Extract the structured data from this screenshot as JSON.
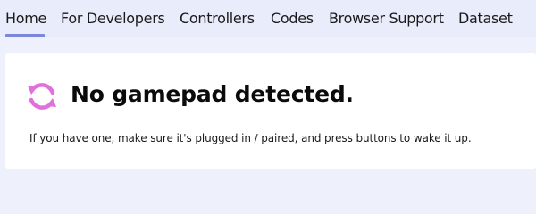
{
  "nav": {
    "items": [
      {
        "label": "Home",
        "active": true
      },
      {
        "label": "For Developers",
        "active": false
      },
      {
        "label": "Controllers",
        "active": false
      },
      {
        "label": "Codes",
        "active": false
      },
      {
        "label": "Browser Support",
        "active": false
      },
      {
        "label": "Dataset",
        "active": false
      }
    ]
  },
  "status": {
    "icon": "sync-icon",
    "title": "No gamepad detected.",
    "message": "If you have one, make sure it's plugged in / paired, and press buttons to wake it up."
  },
  "colors": {
    "page_background": "#eef0fb",
    "nav_underline": "#7b86dc",
    "icon": "#e070da",
    "card_background": "#ffffff"
  }
}
